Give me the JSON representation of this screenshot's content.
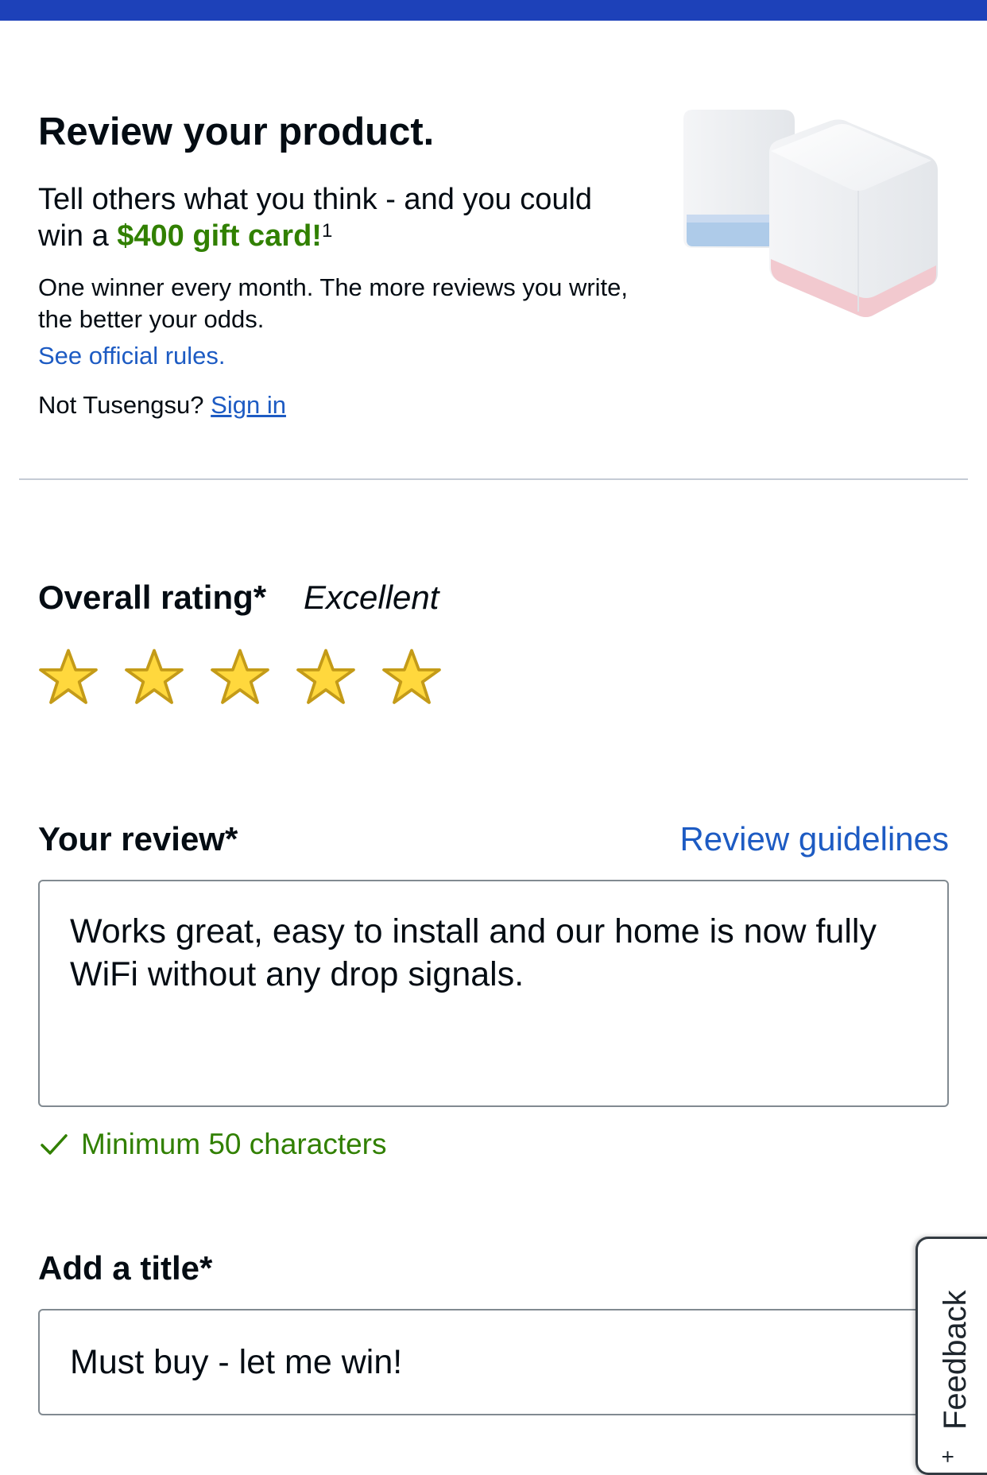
{
  "colors": {
    "brand_blue": "#1d41b9",
    "link_blue": "#1d5bc3",
    "success_green": "#318000",
    "star_fill": "#ffd83d",
    "star_outline": "#c49b18"
  },
  "header": {
    "title": "Review your product."
  },
  "promo": {
    "text_before": "Tell others what you think - and you could win a ",
    "highlight": "$400 gift card!",
    "footnote": "1",
    "odds": "One winner every month. The more reviews you write, the better your odds.",
    "rules_link": "See official rules."
  },
  "account": {
    "prompt": "Not Tusengsu?",
    "sign_in_link": "Sign in"
  },
  "product_image_icon": "mesh-wifi-router-icon",
  "rating": {
    "label": "Overall rating*",
    "value_text": "Excellent",
    "stars_selected": 5,
    "stars_total": 5
  },
  "review": {
    "label": "Your review*",
    "guidelines_link": "Review guidelines",
    "text": "Works great, easy to install and our home is now fully WiFi without any drop signals.",
    "validation_message": "Minimum 50 characters",
    "validation_icon": "checkmark-icon"
  },
  "title_field": {
    "label": "Add a title*",
    "value": "Must buy - let me win!"
  },
  "feedback_tab": {
    "label": "Feedback",
    "icon": "plus-icon"
  }
}
